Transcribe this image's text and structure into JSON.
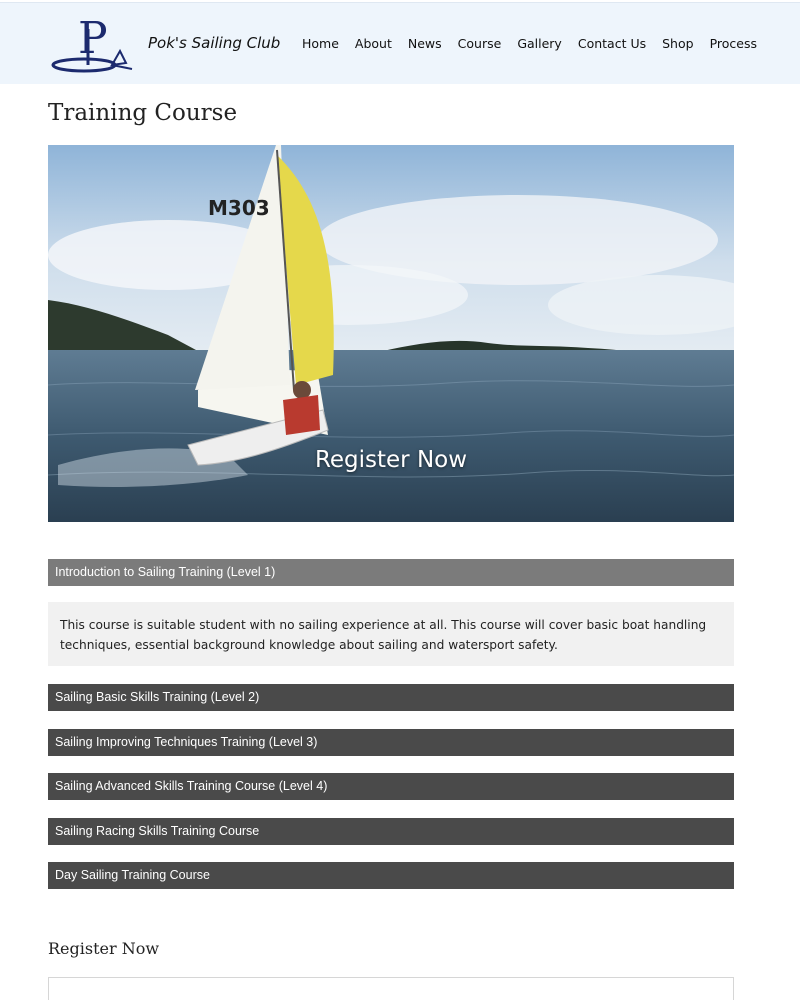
{
  "header": {
    "brand": "Pok's Sailing Club",
    "logo_letter": "P",
    "logo_icon": "sailboat-logo-icon",
    "nav": [
      "Home",
      "About",
      "News",
      "Course",
      "Gallery",
      "Contact Us",
      "Shop",
      "Process"
    ]
  },
  "page": {
    "title": "Training Course"
  },
  "hero": {
    "sail_number": "M303",
    "cta": "Register Now"
  },
  "courses": [
    {
      "label": "Introduction to Sailing Training (Level 1)",
      "expanded": true,
      "description": "This course is suitable student with no sailing experience at all. This course will cover basic boat handling techniques, essential background knowledge about sailing and watersport safety."
    },
    {
      "label": "Sailing Basic Skills Training (Level 2)",
      "expanded": false
    },
    {
      "label": "Sailing Improving Techniques Training (Level 3)",
      "expanded": false
    },
    {
      "label": "Sailing Advanced Skills Training Course (Level 4)",
      "expanded": false
    },
    {
      "label": "Sailing Racing Skills Training Course",
      "expanded": false
    },
    {
      "label": "Day Sailing Training Course",
      "expanded": false
    }
  ],
  "register": {
    "title": "Register Now"
  },
  "colors": {
    "header_bg": "#eef5fc",
    "accordion_header": "#4a4a4a",
    "accordion_header_active": "#7b7b7b",
    "accordion_body": "#f1f1f1",
    "logo": "#1c2a6e"
  }
}
